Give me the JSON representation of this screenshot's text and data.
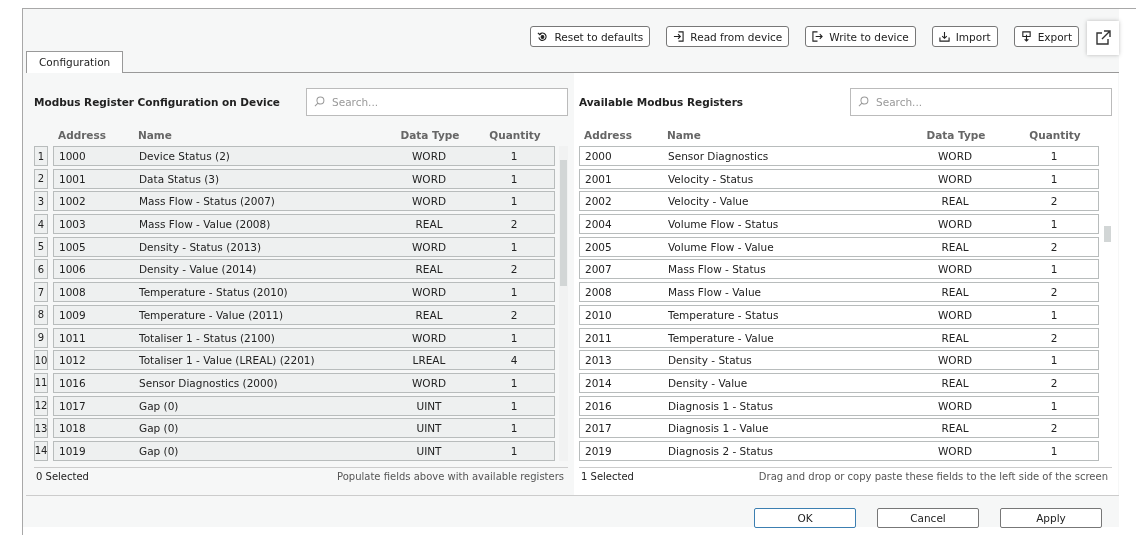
{
  "toolbar": [
    {
      "label": "Reset to defaults",
      "kind": "reset"
    },
    {
      "label": "Read from device",
      "kind": "read"
    },
    {
      "label": "Write to device",
      "kind": "write"
    },
    {
      "label": "Import",
      "kind": "import"
    },
    {
      "label": "Export",
      "kind": "export"
    }
  ],
  "tabs": [
    {
      "label": "Configuration",
      "selected": true
    }
  ],
  "device_panel": {
    "title": "Modbus Register Configuration on Device",
    "search": {
      "placeholder": "Search..."
    },
    "columns": [
      "Address",
      "Name",
      "Data Type",
      "Quantity"
    ],
    "rows": [
      {
        "index": "1",
        "address": "1000",
        "name": "Device Status (2)",
        "data_type": "WORD",
        "quantity": "1"
      },
      {
        "index": "2",
        "address": "1001",
        "name": "Data Status (3)",
        "data_type": "WORD",
        "quantity": "1"
      },
      {
        "index": "3",
        "address": "1002",
        "name": "Mass Flow - Status (2007)",
        "data_type": "WORD",
        "quantity": "1"
      },
      {
        "index": "4",
        "address": "1003",
        "name": "Mass Flow - Value (2008)",
        "data_type": "REAL",
        "quantity": "2"
      },
      {
        "index": "5",
        "address": "1005",
        "name": "Density - Status (2013)",
        "data_type": "WORD",
        "quantity": "1"
      },
      {
        "index": "6",
        "address": "1006",
        "name": "Density - Value (2014)",
        "data_type": "REAL",
        "quantity": "2"
      },
      {
        "index": "7",
        "address": "1008",
        "name": "Temperature - Status (2010)",
        "data_type": "WORD",
        "quantity": "1"
      },
      {
        "index": "8",
        "address": "1009",
        "name": "Temperature - Value (2011)",
        "data_type": "REAL",
        "quantity": "2"
      },
      {
        "index": "9",
        "address": "1011",
        "name": "Totaliser 1 - Status (2100)",
        "data_type": "WORD",
        "quantity": "1"
      },
      {
        "index": "10",
        "address": "1012",
        "name": "Totaliser 1 - Value (LREAL) (2201)",
        "data_type": "LREAL",
        "quantity": "4"
      },
      {
        "index": "11",
        "address": "1016",
        "name": "Sensor Diagnostics (2000)",
        "data_type": "WORD",
        "quantity": "1"
      },
      {
        "index": "12",
        "address": "1017",
        "name": "Gap (0)",
        "data_type": "UINT",
        "quantity": "1"
      },
      {
        "index": "13",
        "address": "1018",
        "name": "Gap (0)",
        "data_type": "UINT",
        "quantity": "1"
      },
      {
        "index": "14",
        "address": "1019",
        "name": "Gap (0)",
        "data_type": "UINT",
        "quantity": "1"
      }
    ],
    "status": "0 Selected",
    "hint": "Populate fields above with available registers"
  },
  "available_panel": {
    "title": "Available Modbus Registers",
    "search": {
      "placeholder": "Search..."
    },
    "columns": [
      "Address",
      "Name",
      "Data Type",
      "Quantity"
    ],
    "rows": [
      {
        "address": "2000",
        "name": "Sensor Diagnostics",
        "data_type": "WORD",
        "quantity": "1"
      },
      {
        "address": "2001",
        "name": "Velocity - Status",
        "data_type": "WORD",
        "quantity": "1"
      },
      {
        "address": "2002",
        "name": "Velocity - Value",
        "data_type": "REAL",
        "quantity": "2"
      },
      {
        "address": "2004",
        "name": "Volume Flow - Status",
        "data_type": "WORD",
        "quantity": "1"
      },
      {
        "address": "2005",
        "name": "Volume Flow - Value",
        "data_type": "REAL",
        "quantity": "2"
      },
      {
        "address": "2007",
        "name": "Mass Flow - Status",
        "data_type": "WORD",
        "quantity": "1"
      },
      {
        "address": "2008",
        "name": "Mass Flow - Value",
        "data_type": "REAL",
        "quantity": "2"
      },
      {
        "address": "2010",
        "name": "Temperature - Status",
        "data_type": "WORD",
        "quantity": "1"
      },
      {
        "address": "2011",
        "name": "Temperature - Value",
        "data_type": "REAL",
        "quantity": "2"
      },
      {
        "address": "2013",
        "name": "Density - Status",
        "data_type": "WORD",
        "quantity": "1"
      },
      {
        "address": "2014",
        "name": "Density - Value",
        "data_type": "REAL",
        "quantity": "2"
      },
      {
        "address": "2016",
        "name": "Diagnosis 1 - Status",
        "data_type": "WORD",
        "quantity": "1"
      },
      {
        "address": "2017",
        "name": "Diagnosis 1 - Value",
        "data_type": "REAL",
        "quantity": "2"
      },
      {
        "address": "2019",
        "name": "Diagnosis 2 - Status",
        "data_type": "WORD",
        "quantity": "1"
      }
    ],
    "status": "1 Selected",
    "hint": "Drag and drop or copy paste these fields to the left side of the screen"
  },
  "buttons": [
    {
      "label": "OK",
      "kind": "default"
    },
    {
      "label": "Cancel",
      "kind": "normal"
    },
    {
      "label": "Apply",
      "kind": "normal"
    }
  ]
}
